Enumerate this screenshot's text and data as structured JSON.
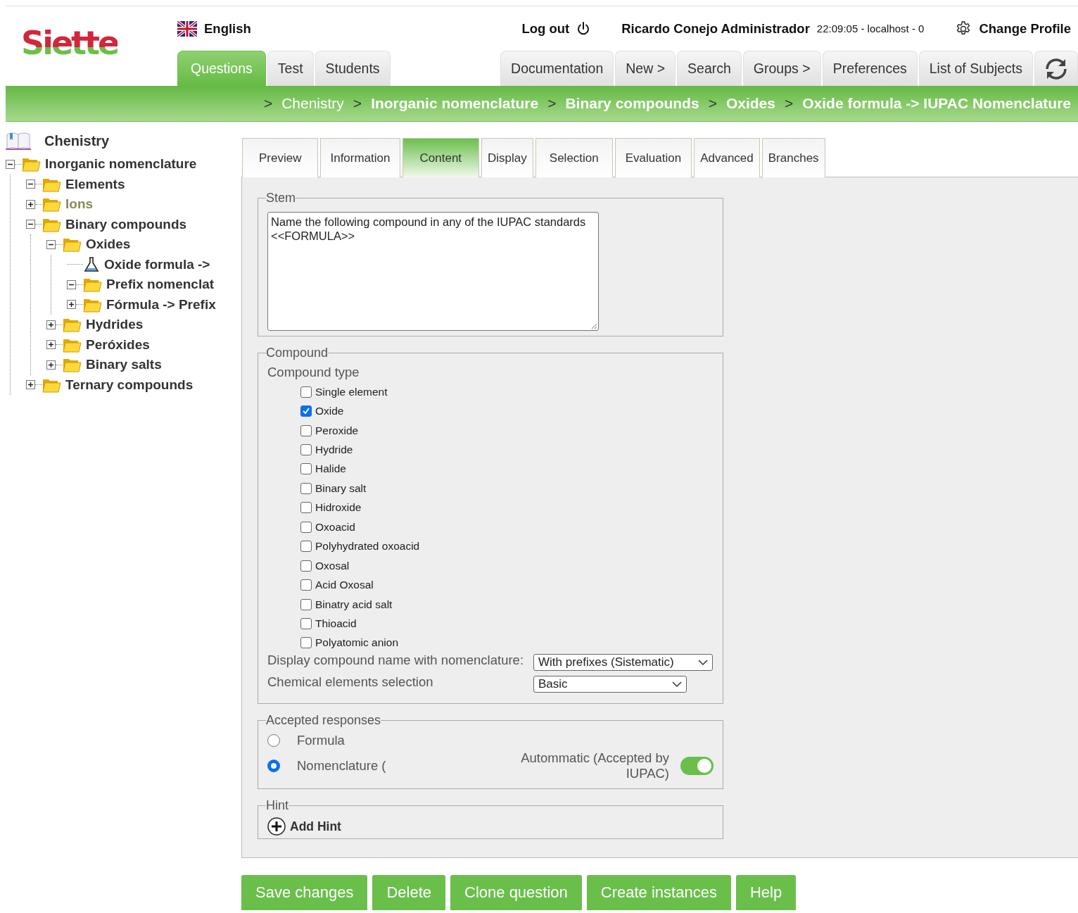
{
  "logo": "Siette",
  "language": "English",
  "logout": "Log out",
  "user": "Ricardo Conejo Administrador",
  "session": "22:09:05 - localhost - 0",
  "change_profile": "Change Profile",
  "main_tabs": [
    {
      "label": "Questions",
      "selected": true
    },
    {
      "label": "Test",
      "selected": false
    },
    {
      "label": "Students",
      "selected": false
    }
  ],
  "menu_tabs": [
    "Documentation",
    "New >",
    "Search",
    "Groups >",
    "Preferences",
    "List of Subjects"
  ],
  "breadcrumb": [
    {
      "label": "Chenistry",
      "emphasized": false
    },
    {
      "label": "Inorganic nomenclature",
      "emphasized": true
    },
    {
      "label": "Binary compounds",
      "emphasized": true
    },
    {
      "label": "Oxides",
      "emphasized": true
    },
    {
      "label": "Oxide formula -> IUPAC Nomenclature",
      "emphasized": true
    }
  ],
  "breadcrumb_separator": ">",
  "tree": {
    "root": "Chenistry",
    "items": [
      {
        "label": "Inorganic nomenclature",
        "kind": "folder",
        "expanded": true,
        "inactive": false,
        "children": [
          {
            "label": "Elements",
            "kind": "folder",
            "expanded": true,
            "inactive": false
          },
          {
            "label": "Ions",
            "kind": "folder",
            "expanded": false,
            "inactive": true
          },
          {
            "label": "Binary compounds",
            "kind": "folder",
            "expanded": true,
            "inactive": false,
            "children": [
              {
                "label": "Oxides",
                "kind": "folder",
                "expanded": true,
                "inactive": false,
                "children": [
                  {
                    "label": "Oxide formula ->",
                    "kind": "question",
                    "inactive": false
                  },
                  {
                    "label": "Prefix nomenclat",
                    "kind": "folder",
                    "expanded": true,
                    "inactive": false
                  },
                  {
                    "label": "Fórmula -> Prefix",
                    "kind": "folder",
                    "expanded": false,
                    "inactive": false
                  }
                ]
              },
              {
                "label": "Hydrides",
                "kind": "folder",
                "expanded": false,
                "inactive": false
              },
              {
                "label": "Peróxides",
                "kind": "folder",
                "expanded": false,
                "inactive": false
              },
              {
                "label": "Binary salts",
                "kind": "folder",
                "expanded": false,
                "inactive": false
              }
            ]
          },
          {
            "label": "Ternary compounds",
            "kind": "folder",
            "expanded": false,
            "inactive": false
          }
        ]
      }
    ]
  },
  "editor_tabs": [
    {
      "label": "Preview",
      "selected": false
    },
    {
      "label": "Information",
      "selected": false
    },
    {
      "label": "Content",
      "selected": true
    },
    {
      "label": "Display",
      "selected": false
    },
    {
      "label": "Selection",
      "selected": false
    },
    {
      "label": "Evaluation",
      "selected": false
    },
    {
      "label": "Advanced",
      "selected": false
    },
    {
      "label": "Branches",
      "selected": false
    }
  ],
  "stem": {
    "legend": "Stem",
    "value": "Name the following compound in any of the IUPAC standards <<FORMULA>>"
  },
  "compound": {
    "legend": "Compound",
    "type_label": "Compound type",
    "types": [
      {
        "label": "Single element",
        "checked": false
      },
      {
        "label": "Oxide",
        "checked": true
      },
      {
        "label": "Peroxide",
        "checked": false
      },
      {
        "label": "Hydride",
        "checked": false
      },
      {
        "label": "Halide",
        "checked": false
      },
      {
        "label": "Binary salt",
        "checked": false
      },
      {
        "label": "Hidroxide",
        "checked": false
      },
      {
        "label": "Oxoacid",
        "checked": false
      },
      {
        "label": "Polyhydrated oxoacid",
        "checked": false
      },
      {
        "label": "Oxosal",
        "checked": false
      },
      {
        "label": "Acid Oxosal",
        "checked": false
      },
      {
        "label": "Binatry acid salt",
        "checked": false
      },
      {
        "label": "Thioacid",
        "checked": false
      },
      {
        "label": "Polyatomic anion",
        "checked": false
      }
    ],
    "nomenclature": {
      "label": "Display compound name with nomenclature:",
      "value": "With prefixes (Sistematic)"
    },
    "elements": {
      "label": "Chemical elements selection",
      "value": "Basic"
    }
  },
  "accepted": {
    "legend": "Accepted responses",
    "options": [
      {
        "label": "Formula",
        "selected": false
      },
      {
        "label": "Nomenclature (",
        "selected": true
      }
    ],
    "toggle": {
      "label": "Autommatic (Accepted by IUPAC)",
      "on": true
    }
  },
  "hint": {
    "legend": "Hint",
    "add": "Add Hint"
  },
  "actions": [
    "Save changes",
    "Delete",
    "Clone question",
    "Create instances",
    "Help"
  ]
}
